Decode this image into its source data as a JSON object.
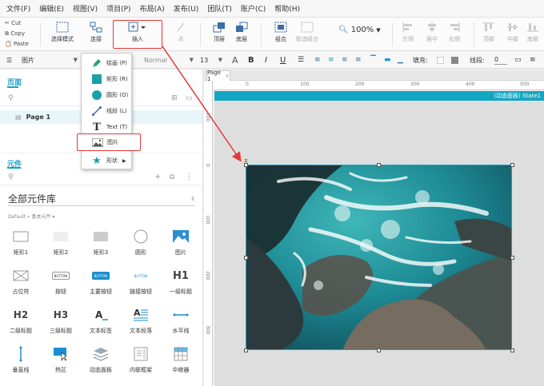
{
  "menubar": [
    "文件(F)",
    "编辑(E)",
    "视图(V)",
    "项目(P)",
    "布局(A)",
    "发布(U)",
    "团队(T)",
    "账户(C)",
    "帮助(H)"
  ],
  "clipboard": {
    "cut": "Cut",
    "copy": "Copy",
    "paste": "Paste"
  },
  "ribbon": {
    "select_mode": "选择模式",
    "connect": "连接",
    "insert": "插入",
    "point": "点",
    "top": "顶层",
    "bottom": "底层",
    "group": "组合",
    "ungroup": "取消组合",
    "zoom": "100%",
    "left": "左侧",
    "center": "居中",
    "right": "右侧",
    "top_align": "顶部",
    "middle": "中部",
    "bottom_align": "底部"
  },
  "format": {
    "widget_type": "图片",
    "font_style": "Normal",
    "font_size": "13",
    "fill_label": "填充:",
    "line_label": "线段:",
    "line_value": "0"
  },
  "pages": {
    "title": "页面",
    "items": [
      "Page 1"
    ]
  },
  "library": {
    "title": "元件",
    "dropdown": "全部元件库",
    "breadcrumb": "Default » 基本元件 ▾",
    "widgets": [
      "矩形1",
      "矩形2",
      "矩形3",
      "圆形",
      "图片",
      "占位符",
      "按钮",
      "主要按钮",
      "链接按钮",
      "一级标题",
      "二级标题",
      "三级标题",
      "文本标签",
      "文本段落",
      "水平线",
      "垂直线",
      "热区",
      "动态面板",
      "内联框架",
      "中继器"
    ],
    "button_text": "BUTTON",
    "h1": "H1",
    "h2": "H2",
    "h3": "H3"
  },
  "canvas": {
    "tab": "Page 1",
    "dynamic_panel": "(动态面板) State1",
    "h_ticks": [
      "0",
      "100",
      "200",
      "300",
      "400",
      "500"
    ],
    "v_ticks": [
      "100",
      "0",
      "100",
      "200",
      "300"
    ]
  },
  "insert_menu": [
    {
      "label": "绘画 (P)",
      "icon": "pen-icon"
    },
    {
      "label": "矩形 (R)",
      "icon": "rectangle-icon"
    },
    {
      "label": "圆形 (O)",
      "icon": "ellipse-icon"
    },
    {
      "label": "线段 (L)",
      "icon": "line-icon"
    },
    {
      "label": "Text (T)",
      "icon": "text-icon"
    },
    {
      "label": "图片",
      "icon": "image-icon"
    },
    {
      "label": "形状",
      "icon": "star-icon"
    }
  ],
  "colors": {
    "accent": "#1aa0c3",
    "highlight": "#e53935",
    "dynamic_bar": "#13a6c2"
  }
}
